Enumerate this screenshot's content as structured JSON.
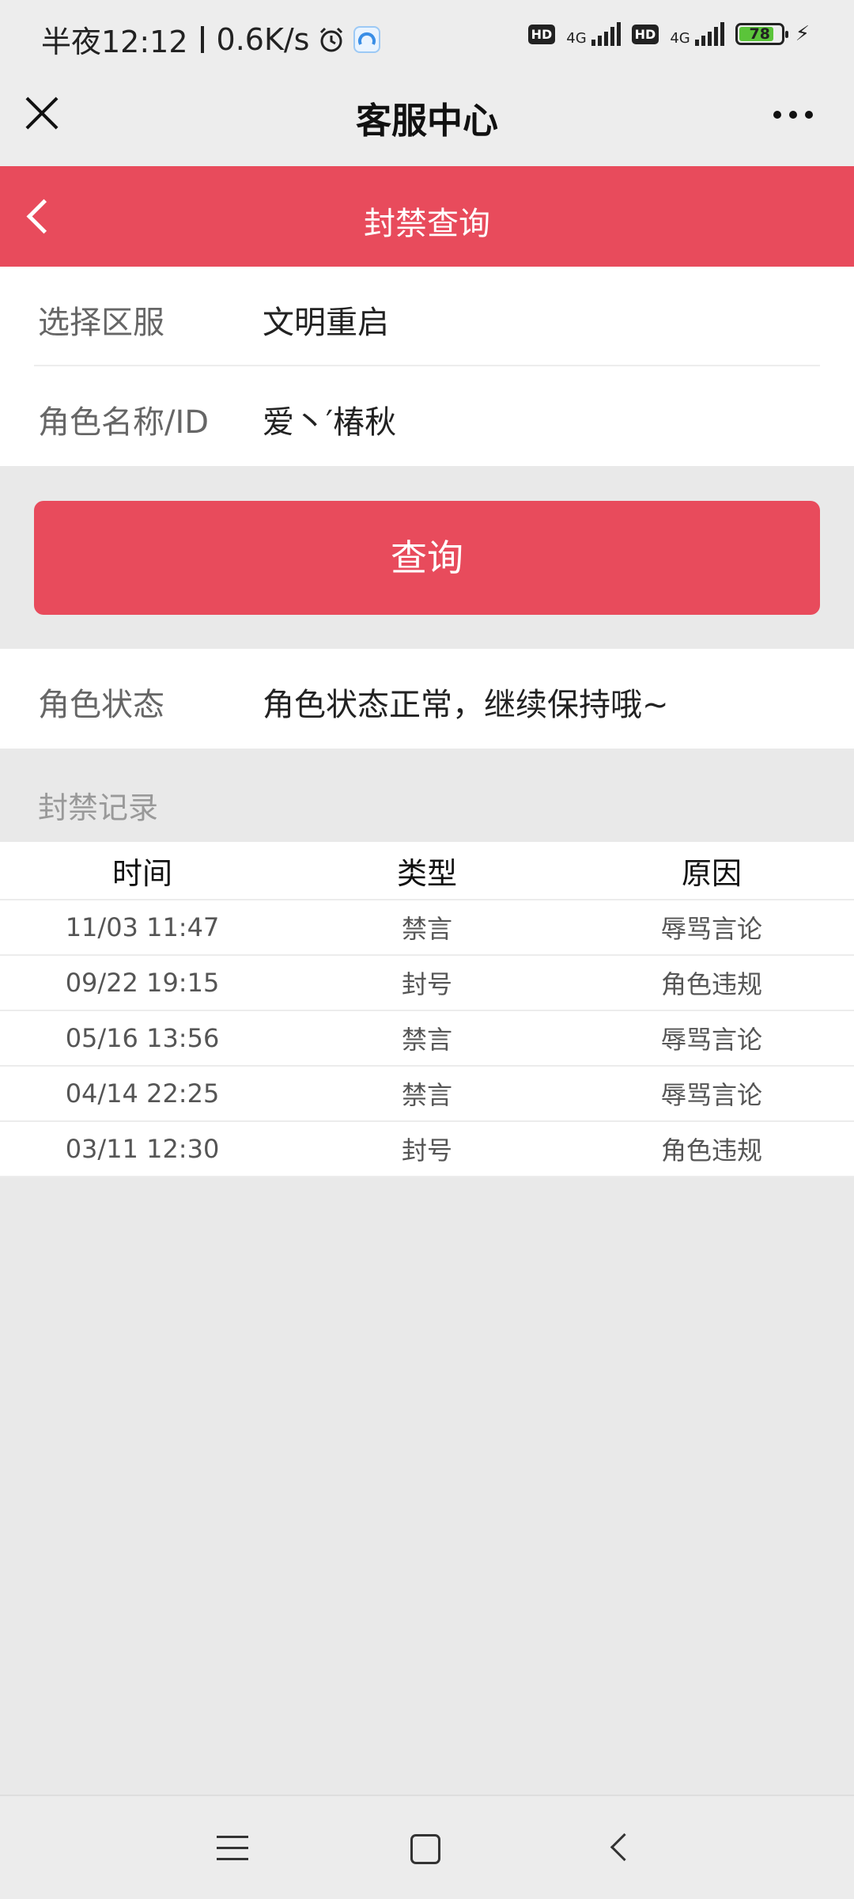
{
  "status_bar": {
    "time_text": "半夜12:12",
    "speed_text": "0.6K/s",
    "battery": "78",
    "network": "4G",
    "hd": "HD"
  },
  "title_bar": {
    "title": "客服中心"
  },
  "header": {
    "title": "封禁查询"
  },
  "form": {
    "server_label": "选择区服",
    "server_value": "文明重启",
    "role_label": "角色名称/ID",
    "role_value": "爱丶′椿秋"
  },
  "query_button": "查询",
  "role_status": {
    "label": "角色状态",
    "value": "角色状态正常，继续保持哦~"
  },
  "records": {
    "title": "封禁记录",
    "columns": [
      "时间",
      "类型",
      "原因"
    ],
    "rows": [
      [
        "11/03 11:47",
        "禁言",
        "辱骂言论"
      ],
      [
        "09/22 19:15",
        "封号",
        "角色违规"
      ],
      [
        "05/16 13:56",
        "禁言",
        "辱骂言论"
      ],
      [
        "04/14 22:25",
        "禁言",
        "辱骂言论"
      ],
      [
        "03/11 12:30",
        "封号",
        "角色违规"
      ]
    ]
  },
  "colors": {
    "accent": "#e84b5c",
    "background": "#e9e9e9"
  }
}
